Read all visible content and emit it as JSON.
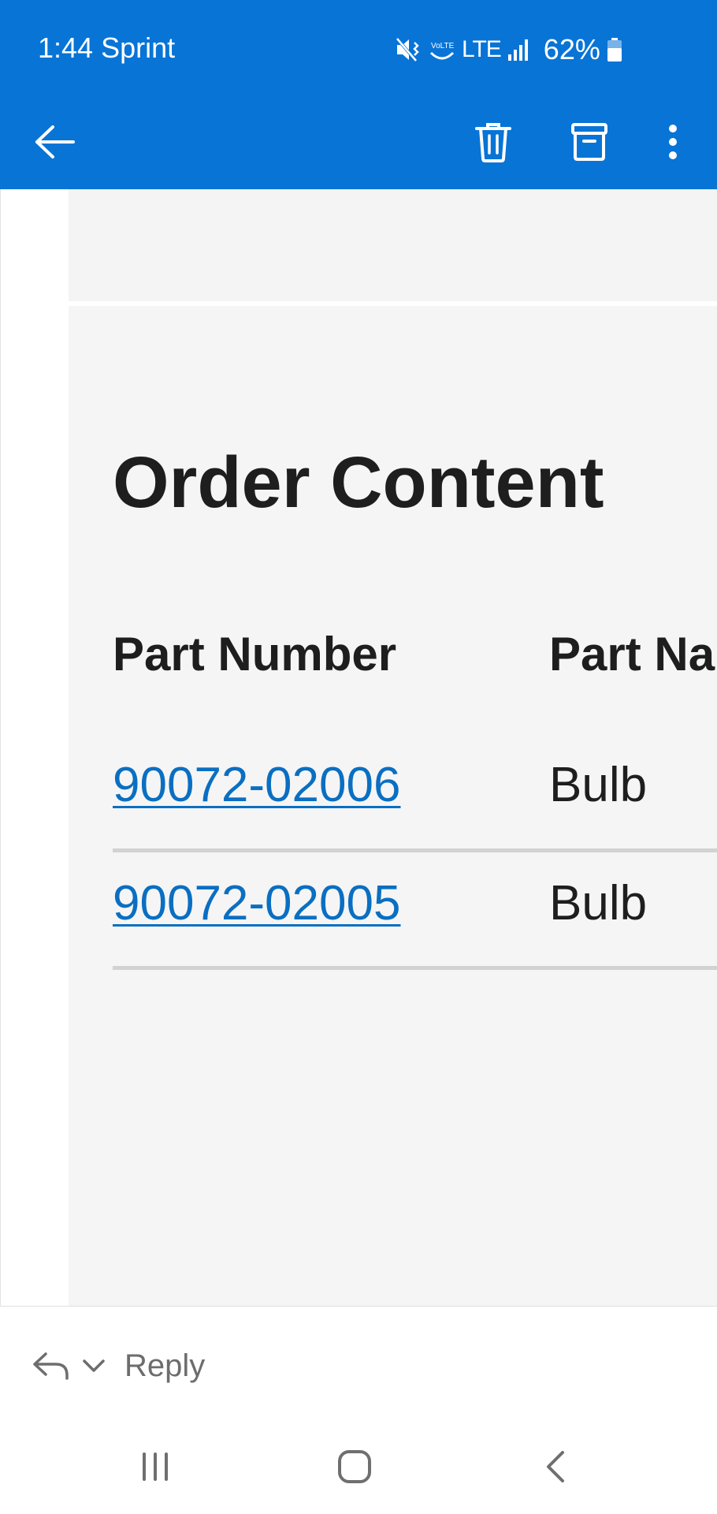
{
  "status_bar": {
    "time_carrier": "1:44 Sprint",
    "network_label": "LTE",
    "battery_percent": "62%"
  },
  "app_bar": {
    "back_icon": "arrow-left-icon",
    "delete_icon": "trash-icon",
    "archive_icon": "archive-icon",
    "more_icon": "more-vertical-icon"
  },
  "email": {
    "heading": "Order Content",
    "table": {
      "headers": [
        "Part Number",
        "Part Na"
      ],
      "rows": [
        {
          "part_number": "90072-02006",
          "part_name": "Bulb"
        },
        {
          "part_number": "90072-02005",
          "part_name": "Bulb"
        }
      ]
    }
  },
  "reply_bar": {
    "reply_label": "Reply"
  },
  "colors": {
    "header_blue": "#0874d6",
    "link_blue": "#0a6fc2",
    "content_bg": "#f5f5f5"
  }
}
